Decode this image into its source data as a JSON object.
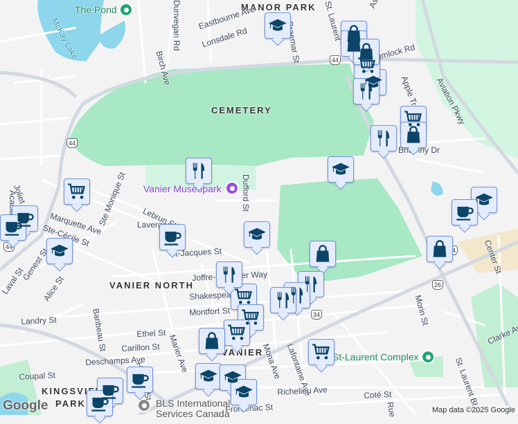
{
  "map": {
    "areas": [
      "MANOR PARK",
      "CEMETERY",
      "VANIER NORTH",
      "VANIER",
      "KINGSVIEW",
      "PARK"
    ],
    "pois": {
      "pond": "The Pond",
      "museopark": "Vanier Museopark",
      "complex": "St-Laurent Complex",
      "bls1": "BLS International",
      "bls2": "Services Canada"
    },
    "water": "McKay Lake",
    "streets": [
      "Dunvegan Rd",
      "Eastbourne Ave",
      "Lonsdale Rd",
      "Birch Ave",
      "Braemar St",
      "St. Laurent",
      "Ashton Terrace",
      "Hemlock Rd",
      "Apple Tree",
      "Aviation Pkwy",
      "Britanny Dr",
      "Dufford St",
      "Lebrun St",
      "Lavergne",
      "Joliet Ave",
      "Marquette Ave",
      "Ste-Cécile St",
      "Ste Monique St",
      "St-Jacques St",
      "Joffre-Belanger Way",
      "Shakespeare",
      "Montfort St",
      "Genest St",
      "Laval St",
      "Alice St",
      "Landry St",
      "Baribeau St",
      "Ethel St",
      "Carillon St",
      "Marier Ave",
      "Deschamps Ave",
      "Hannah St",
      "Coupal St",
      "Mona Ave",
      "Lafontaine Ave",
      "Richelieu Ave",
      "Coté St",
      "Frontenac St",
      "Rue",
      "Morin St",
      "Center St",
      "Clarke Ave",
      "St. Laurent Blvd",
      "Acacia Ave"
    ],
    "route_shields": [
      "44",
      "44",
      "44",
      "34",
      "26",
      "44"
    ],
    "colors": {
      "marker_icon": "#0d4569",
      "marker_bg": "#e4ecfb",
      "park": "#a8e8c4",
      "water": "#8dd6ec"
    },
    "markers": [
      {
        "type": "education",
        "icon": "graduation-cap-icon"
      },
      {
        "type": "education",
        "icon": "graduation-cap-icon"
      },
      {
        "type": "education",
        "icon": "graduation-cap-icon"
      },
      {
        "type": "education",
        "icon": "graduation-cap-icon"
      },
      {
        "type": "education",
        "icon": "graduation-cap-icon"
      },
      {
        "type": "education",
        "icon": "graduation-cap-icon"
      },
      {
        "type": "education",
        "icon": "graduation-cap-icon"
      },
      {
        "type": "education",
        "icon": "graduation-cap-icon"
      },
      {
        "type": "education",
        "icon": "graduation-cap-icon"
      },
      {
        "type": "grocery",
        "icon": "shopping-cart-icon"
      },
      {
        "type": "grocery",
        "icon": "shopping-cart-icon"
      },
      {
        "type": "grocery",
        "icon": "shopping-cart-icon"
      },
      {
        "type": "grocery",
        "icon": "shopping-cart-icon"
      },
      {
        "type": "grocery",
        "icon": "shopping-cart-icon"
      },
      {
        "type": "grocery",
        "icon": "shopping-cart-icon"
      },
      {
        "type": "grocery",
        "icon": "shopping-cart-icon"
      },
      {
        "type": "shopping",
        "icon": "shopping-bag-icon"
      },
      {
        "type": "shopping",
        "icon": "shopping-bag-icon"
      },
      {
        "type": "shopping",
        "icon": "shopping-bag-icon"
      },
      {
        "type": "shopping",
        "icon": "shopping-bag-icon"
      },
      {
        "type": "shopping",
        "icon": "shopping-bag-icon"
      },
      {
        "type": "shopping",
        "icon": "shopping-bag-icon"
      },
      {
        "type": "shopping",
        "icon": "shopping-bag-icon"
      },
      {
        "type": "restaurant",
        "icon": "fork-knife-icon"
      },
      {
        "type": "restaurant",
        "icon": "fork-knife-icon"
      },
      {
        "type": "restaurant",
        "icon": "fork-knife-icon"
      },
      {
        "type": "restaurant",
        "icon": "fork-knife-icon"
      },
      {
        "type": "restaurant",
        "icon": "fork-knife-icon"
      },
      {
        "type": "restaurant",
        "icon": "fork-knife-icon"
      },
      {
        "type": "restaurant",
        "icon": "fork-knife-icon"
      },
      {
        "type": "cafe",
        "icon": "coffee-cup-icon"
      },
      {
        "type": "cafe",
        "icon": "coffee-cup-icon"
      },
      {
        "type": "cafe",
        "icon": "coffee-cup-icon"
      },
      {
        "type": "cafe",
        "icon": "coffee-cup-icon"
      },
      {
        "type": "cafe",
        "icon": "coffee-cup-icon"
      },
      {
        "type": "cafe",
        "icon": "coffee-cup-icon"
      },
      {
        "type": "cafe",
        "icon": "coffee-cup-icon"
      }
    ]
  },
  "footer": {
    "logo": "Google",
    "attribution": "Map data ©2025 Google"
  }
}
